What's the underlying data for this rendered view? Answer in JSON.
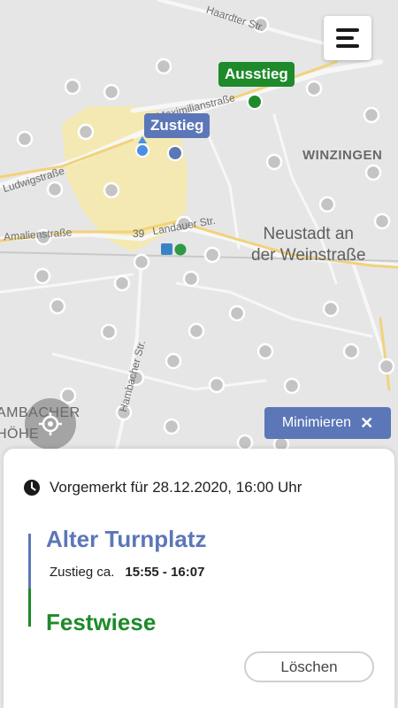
{
  "map": {
    "labels": {
      "winzingen": "WINZINGEN",
      "neustadt_line1": "Neustadt an",
      "neustadt_line2": "der Weinstraße",
      "hambach_line1": "AMBACHER",
      "hambach_line2": "HÖHE"
    },
    "streets": {
      "haardter": "Haardter Str.",
      "maximilian": "Maximilianstraße",
      "ludwig": "Ludwigstraße",
      "amalien": "Amalienstraße",
      "landauer": "Landauer Str.",
      "hambacher": "Hambacher Str.",
      "route_number": "39"
    },
    "transit_icon": "train-station-icon",
    "colors": {
      "stop_dot": "#c4c4c4",
      "road": "#f2f2f2",
      "highlight": "#f6e6a6"
    }
  },
  "markers": {
    "dropoff_label": "Ausstieg",
    "pickup_label": "Zustieg"
  },
  "controls": {
    "menu_icon": "hamburger-menu-icon",
    "locate_icon": "locate-icon",
    "minimize_label": "Minimieren",
    "minimize_close_glyph": "✕"
  },
  "booking": {
    "status_text": "Vorgemerkt für 28.12.2020, 16:00 Uhr",
    "from_stop": "Alter Turnplatz",
    "pickup_prefix": "Zustieg ca.",
    "pickup_window": "15:55 - 16:07",
    "to_stop": "Festwiese",
    "delete_label": "Löschen"
  },
  "colors": {
    "blue": "#5c77b8",
    "green": "#1e8a2a",
    "panel_bg": "#ffffff"
  }
}
